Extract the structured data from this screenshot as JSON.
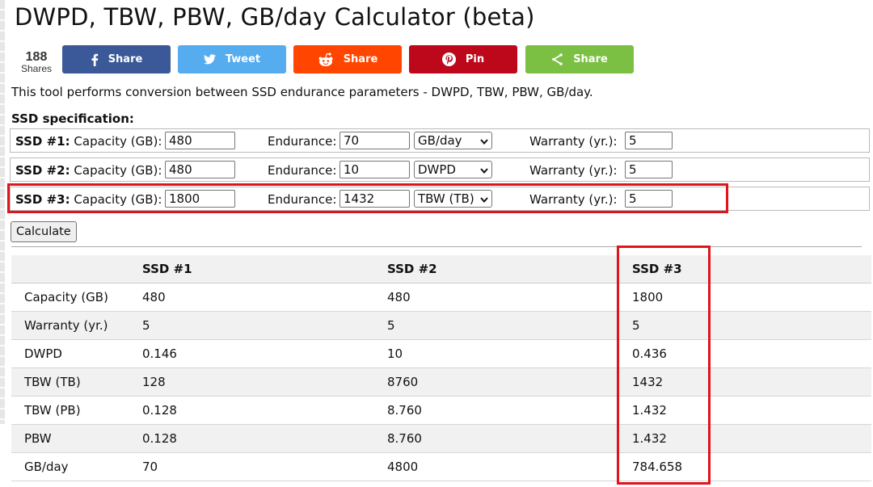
{
  "page": {
    "title": "DWPD, TBW, PBW, GB/day Calculator (beta)",
    "intro": "This tool performs conversion between SSD endurance parameters - DWPD, TBW, PBW, GB/day.",
    "spec_title": "SSD specification:"
  },
  "shares": {
    "count": "188",
    "count_label": "Shares",
    "buttons": [
      {
        "label": "Share",
        "icon": "facebook-icon",
        "color": "#3b5998"
      },
      {
        "label": "Tweet",
        "icon": "twitter-icon",
        "color": "#55acee"
      },
      {
        "label": "Share",
        "icon": "reddit-icon",
        "color": "#ff4500"
      },
      {
        "label": "Pin",
        "icon": "pinterest-icon",
        "color": "#bd081c"
      },
      {
        "label": "Share",
        "icon": "share-icon",
        "color": "#7bc043"
      }
    ]
  },
  "ssds": [
    {
      "name": "SSD #1:",
      "capacity_label": "Capacity (GB):",
      "capacity": "480",
      "endurance_label": "Endurance:",
      "endurance": "70",
      "unit": "GB/day",
      "warranty_label": "Warranty (yr.):",
      "warranty": "5"
    },
    {
      "name": "SSD #2:",
      "capacity_label": "Capacity (GB):",
      "capacity": "480",
      "endurance_label": "Endurance:",
      "endurance": "10",
      "unit": "DWPD",
      "warranty_label": "Warranty (yr.):",
      "warranty": "5"
    },
    {
      "name": "SSD #3:",
      "capacity_label": "Capacity (GB):",
      "capacity": "1800",
      "endurance_label": "Endurance:",
      "endurance": "1432",
      "unit": "TBW (TB)",
      "warranty_label": "Warranty (yr.):",
      "warranty": "5"
    }
  ],
  "calculate_label": "Calculate",
  "results": {
    "headers": [
      "",
      "SSD #1",
      "SSD #2",
      "SSD #3"
    ],
    "rows": [
      [
        "Capacity (GB)",
        "480",
        "480",
        "1800"
      ],
      [
        "Warranty (yr.)",
        "5",
        "5",
        "5"
      ],
      [
        "DWPD",
        "0.146",
        "10",
        "0.436"
      ],
      [
        "TBW (TB)",
        "128",
        "8760",
        "1432"
      ],
      [
        "TBW (PB)",
        "0.128",
        "8.760",
        "1.432"
      ],
      [
        "PBW",
        "0.128",
        "8.760",
        "1.432"
      ],
      [
        "GB/day",
        "70",
        "4800",
        "784.658"
      ]
    ]
  },
  "highlight_color": "#e0141b"
}
